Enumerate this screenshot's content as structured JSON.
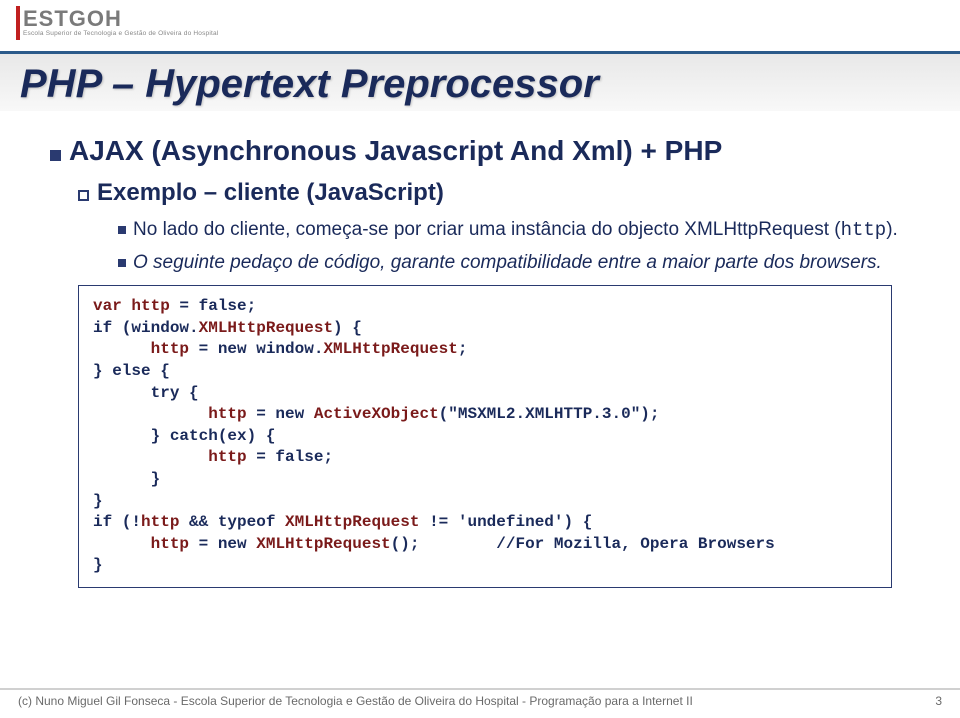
{
  "header": {
    "logo_main": "ESTGOH",
    "logo_sub": "Escola Superior de Tecnologia e Gestão de Oliveira do Hospital"
  },
  "title": "PHP – Hypertext Preprocessor",
  "content": {
    "l1": "AJAX (Asynchronous Javascript And Xml) + PHP",
    "l2": "Exemplo – cliente (JavaScript)",
    "l3a_pre": "No lado do cliente, começa-se por criar uma instância do objecto XMLHttpRequest (",
    "l3a_mono": "http",
    "l3a_post": ").",
    "l3b": "O seguinte pedaço de código, garante compatibilidade entre a maior parte dos browsers."
  },
  "code": {
    "lines": [
      {
        "indent": 0,
        "parts": [
          {
            "t": "var ",
            "c": "kw-var"
          },
          {
            "t": "http",
            " c": "kw-var",
            "c": "kw-var"
          },
          {
            "t": " = false;",
            "c": ""
          }
        ]
      },
      {
        "indent": 0,
        "parts": [
          {
            "t": "if (window.",
            "c": ""
          },
          {
            "t": "XMLHttpRequest",
            "c": "kw-var"
          },
          {
            "t": ") {",
            "c": ""
          }
        ]
      },
      {
        "indent": 1,
        "parts": [
          {
            "t": "http",
            "c": "kw-var"
          },
          {
            "t": " = new window.",
            "c": ""
          },
          {
            "t": "XMLHttpRequest",
            "c": "kw-var"
          },
          {
            "t": ";",
            "c": ""
          }
        ]
      },
      {
        "indent": 0,
        "parts": [
          {
            "t": "} else {",
            "c": ""
          }
        ]
      },
      {
        "indent": 1,
        "parts": [
          {
            "t": "try {",
            "c": ""
          }
        ]
      },
      {
        "indent": 2,
        "parts": [
          {
            "t": "http",
            "c": "kw-var"
          },
          {
            "t": " = new ",
            "c": ""
          },
          {
            "t": "ActiveXObject",
            "c": "kw-var"
          },
          {
            "t": "(\"MSXML2.XMLHTTP.3.0\");",
            "c": ""
          }
        ]
      },
      {
        "indent": 1,
        "parts": [
          {
            "t": "} catch(ex) {",
            "c": ""
          }
        ]
      },
      {
        "indent": 2,
        "parts": [
          {
            "t": "http",
            "c": "kw-var"
          },
          {
            "t": " = false;",
            "c": ""
          }
        ]
      },
      {
        "indent": 1,
        "parts": [
          {
            "t": "}",
            "c": ""
          }
        ]
      },
      {
        "indent": 0,
        "parts": [
          {
            "t": "}",
            "c": ""
          }
        ]
      },
      {
        "indent": 0,
        "parts": [
          {
            "t": "if (!",
            "c": ""
          },
          {
            "t": "http",
            "c": "kw-var"
          },
          {
            "t": " && typeof ",
            "c": ""
          },
          {
            "t": "XMLHttpRequest",
            "c": "kw-var"
          },
          {
            "t": " != 'undefined') {",
            "c": ""
          }
        ]
      },
      {
        "indent": 1,
        "parts": [
          {
            "t": "http",
            "c": "kw-var"
          },
          {
            "t": " = new ",
            "c": ""
          },
          {
            "t": "XMLHttpRequest",
            "c": "kw-var"
          },
          {
            "t": "();        //For Mozilla, Opera Browsers",
            "c": ""
          }
        ]
      },
      {
        "indent": 0,
        "parts": [
          {
            "t": "}",
            "c": ""
          }
        ]
      }
    ]
  },
  "footer": {
    "left": "(c) Nuno Miguel Gil Fonseca  -  Escola Superior de Tecnologia e Gestão de Oliveira do Hospital  -  Programação para a Internet II",
    "page": "3"
  }
}
